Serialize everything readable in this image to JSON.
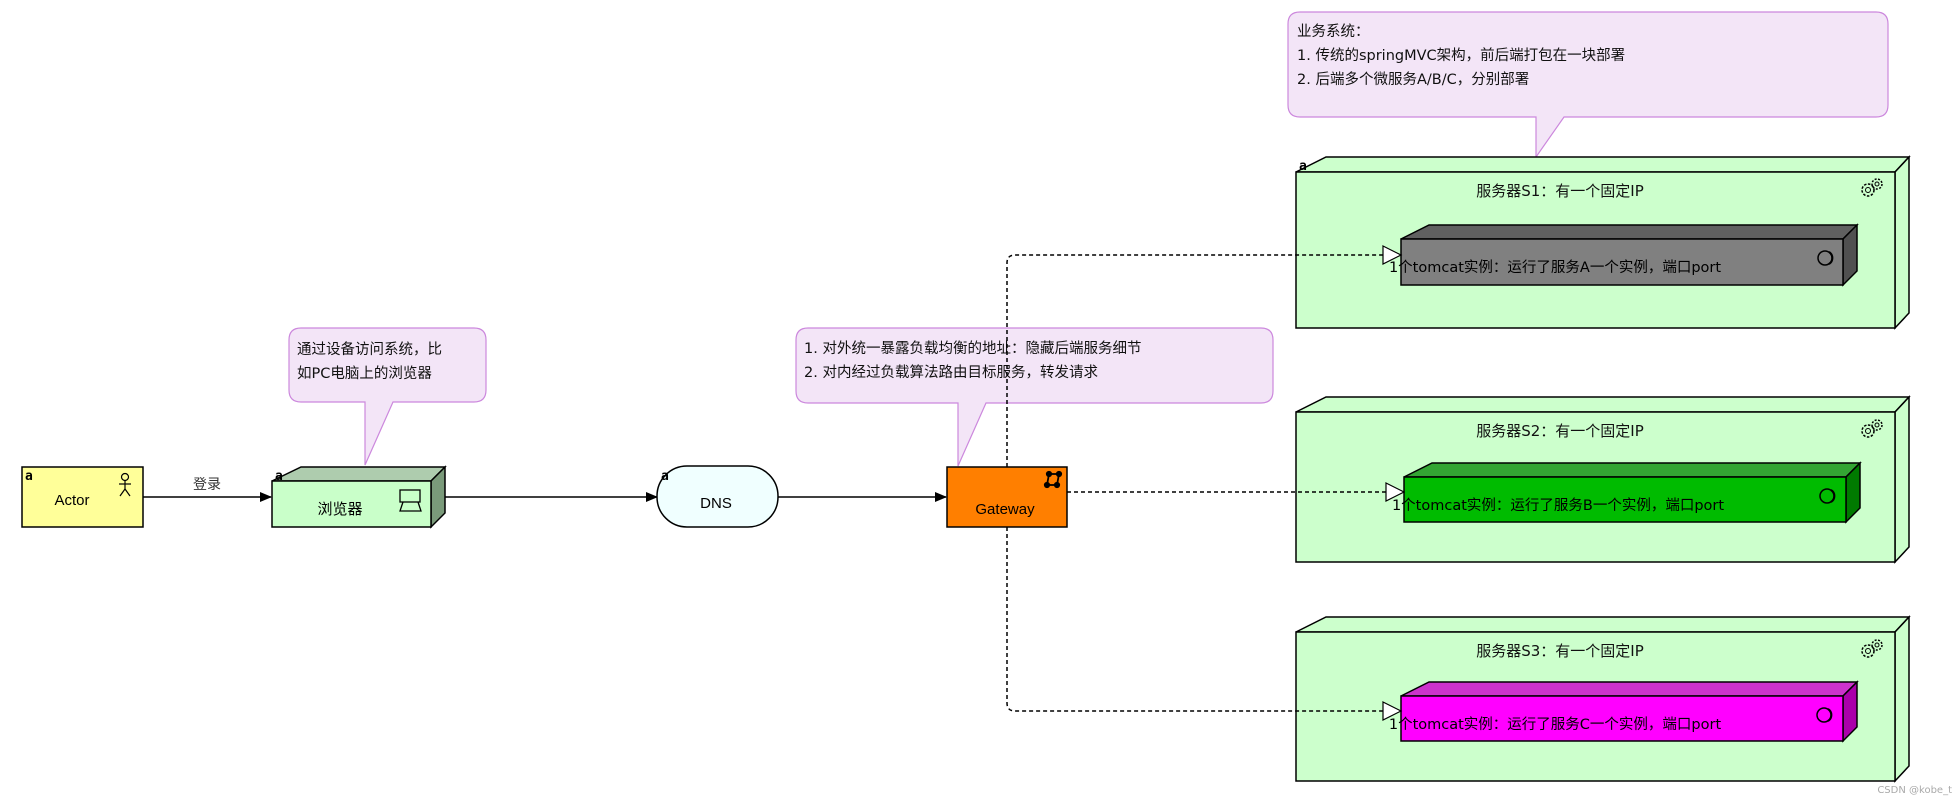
{
  "actor": {
    "label": "Actor",
    "icon": "stick-figure-icon",
    "fill": "#ffff99"
  },
  "edge_login": {
    "label": "登录"
  },
  "browser": {
    "label": "浏览器",
    "icon": "monitor-icon",
    "fill": "#c9ffc9",
    "top_fill": "#aeccae",
    "side_fill": "#7a9a7a"
  },
  "browser_note": {
    "lines": [
      "通过设备访问系统，比",
      "如PC电脑上的浏览器"
    ]
  },
  "dns": {
    "label": "DNS",
    "fill": "#f0ffff"
  },
  "gateway": {
    "label": "Gateway",
    "icon": "network-icon",
    "fill": "#ff7f00"
  },
  "gateway_note": {
    "lines": [
      "1. 对外统一暴露负载均衡的地址：隐藏后端服务细节",
      "2. 对内经过负载算法路由目标服务，转发请求"
    ]
  },
  "system_note": {
    "lines": [
      "业务系统：",
      "1. 传统的springMVC架构，前后端打包在一块部署",
      "2. 后端多个微服务A/B/C，分别部署"
    ]
  },
  "servers": [
    {
      "title": "服务器S1：有一个固定IP",
      "icon": "gears-icon",
      "tomcat": {
        "label": "1个tomcat实例：运行了服务A一个实例，端口port",
        "fill": "#808080",
        "top": "#606060",
        "side": "#505050",
        "icon": "interface-circle-icon"
      }
    },
    {
      "title": "服务器S2：有一个固定IP",
      "icon": "gears-icon",
      "tomcat": {
        "label": "1个tomcat实例：运行了服务B一个实例，端口port",
        "fill": "#00bb00",
        "top": "#33a533",
        "side": "#007a00",
        "icon": "interface-circle-icon"
      }
    },
    {
      "title": "服务器S3：有一个固定IP",
      "icon": "gears-icon",
      "tomcat": {
        "label": "1个tomcat实例：运行了服务C一个实例，端口port",
        "fill": "#ff00ff",
        "top": "#cc33cc",
        "side": "#aa00aa",
        "icon": "interface-circle-icon"
      }
    }
  ],
  "colors": {
    "note_fill": "#f3e5f7",
    "note_stroke": "#cc88dd",
    "node_fill": "#ccffcc",
    "node_top": "#ccffcc"
  },
  "element_marker": "a",
  "watermark": "CSDN @kobe_t"
}
